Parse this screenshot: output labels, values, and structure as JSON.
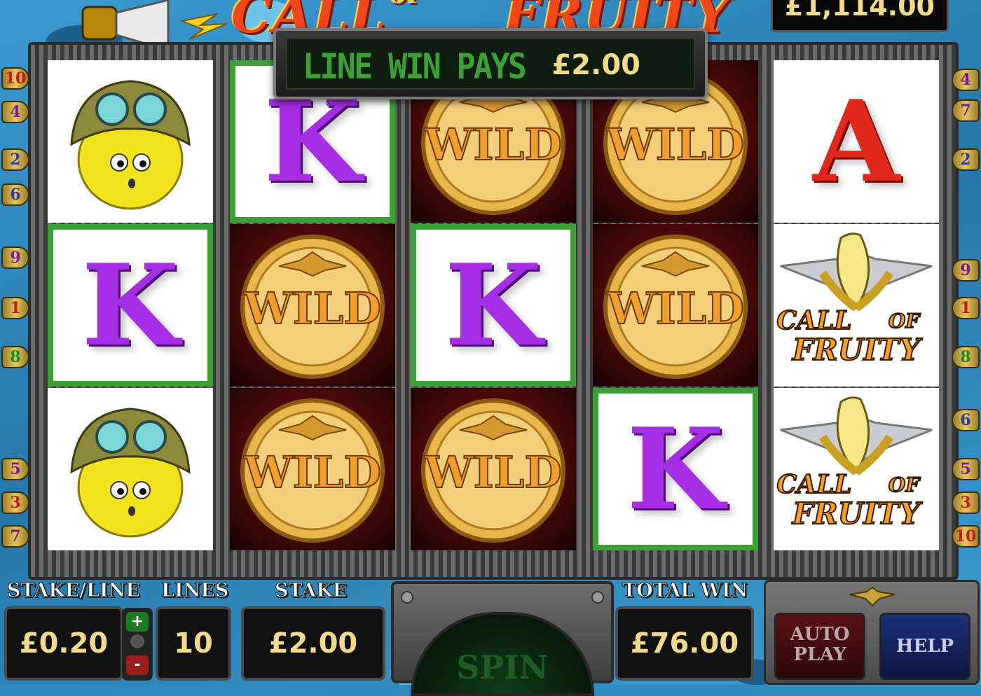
{
  "title": {
    "part1": "CALL",
    "of": "OF",
    "part2": "FRUITY"
  },
  "credit": "£1,114.00",
  "popup": {
    "label": "LINE WIN PAYS",
    "value": "£2.00"
  },
  "line_indicators": {
    "left": [
      "10",
      "4",
      "2",
      "6",
      "9",
      "1",
      "8",
      "5",
      "3",
      "7"
    ],
    "right": [
      "4",
      "7",
      "2",
      "9",
      "1",
      "8",
      "6",
      "5",
      "3",
      "10"
    ]
  },
  "reels": [
    [
      {
        "symbol": "pilot-lemon"
      },
      {
        "symbol": "K",
        "win": true
      },
      {
        "symbol": "pilot-lemon"
      }
    ],
    [
      {
        "symbol": "K",
        "win": true
      },
      {
        "symbol": "WILD"
      },
      {
        "symbol": "WILD"
      }
    ],
    [
      {
        "symbol": "WILD"
      },
      {
        "symbol": "K",
        "win": true
      },
      {
        "symbol": "WILD"
      }
    ],
    [
      {
        "symbol": "WILD"
      },
      {
        "symbol": "WILD"
      },
      {
        "symbol": "K",
        "win": true
      }
    ],
    [
      {
        "symbol": "A"
      },
      {
        "symbol": "call-of-fruity-banana"
      },
      {
        "symbol": "call-of-fruity-banana"
      }
    ]
  ],
  "symbol_text": {
    "wild": "WILD",
    "logo_line1": "CALL",
    "logo_of": "OF",
    "logo_line2": "FRUITY"
  },
  "bottom": {
    "stake_line_label": "STAKE/LINE",
    "stake_line_value": "£0.20",
    "lines_label": "LINES",
    "lines_value": "10",
    "stake_label": "STAKE",
    "stake_value": "£2.00",
    "spin_label": "SPIN",
    "total_win_label": "TOTAL WIN",
    "total_win_value": "£76.00",
    "auto_play_label": "AUTO PLAY",
    "help_label": "HELP",
    "plus": "+",
    "minus": "-"
  },
  "colors": {
    "win_border": "#3aa233",
    "k": "#a62ee6",
    "a": "#e0281c",
    "value_text": "#f3d98a"
  }
}
